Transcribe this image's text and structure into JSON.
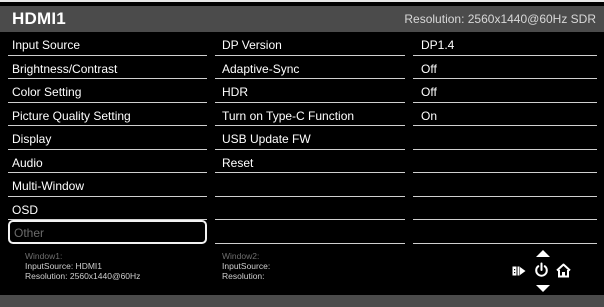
{
  "header": {
    "title": "HDMI1",
    "resolution": "Resolution: 2560x1440@60Hz SDR"
  },
  "menu": [
    {
      "label": "Input Source"
    },
    {
      "label": "Brightness/Contrast"
    },
    {
      "label": "Color Setting"
    },
    {
      "label": "Picture Quality Setting"
    },
    {
      "label": "Display"
    },
    {
      "label": "Audio"
    },
    {
      "label": "Multi-Window"
    },
    {
      "label": "OSD"
    },
    {
      "label": "Other"
    }
  ],
  "submenu": [
    {
      "label": "DP Version",
      "value": "DP1.4"
    },
    {
      "label": "Adaptive-Sync",
      "value": "Off"
    },
    {
      "label": "HDR",
      "value": "Off"
    },
    {
      "label": "Turn on Type-C Function",
      "value": "On"
    },
    {
      "label": "USB Update FW",
      "value": ""
    },
    {
      "label": "Reset",
      "value": ""
    }
  ],
  "info": {
    "window1": {
      "caption": "Window1:",
      "input": "InputSource: HDMI1",
      "resolution": "Resolution: 2560x1440@60Hz"
    },
    "window2": {
      "caption": "Window2:",
      "input": "InputSource:",
      "resolution": "Resolution:"
    }
  },
  "controls": {
    "icons": [
      "up-arrow-icon",
      "input-icon",
      "power-icon",
      "home-icon",
      "down-arrow-icon"
    ]
  }
}
